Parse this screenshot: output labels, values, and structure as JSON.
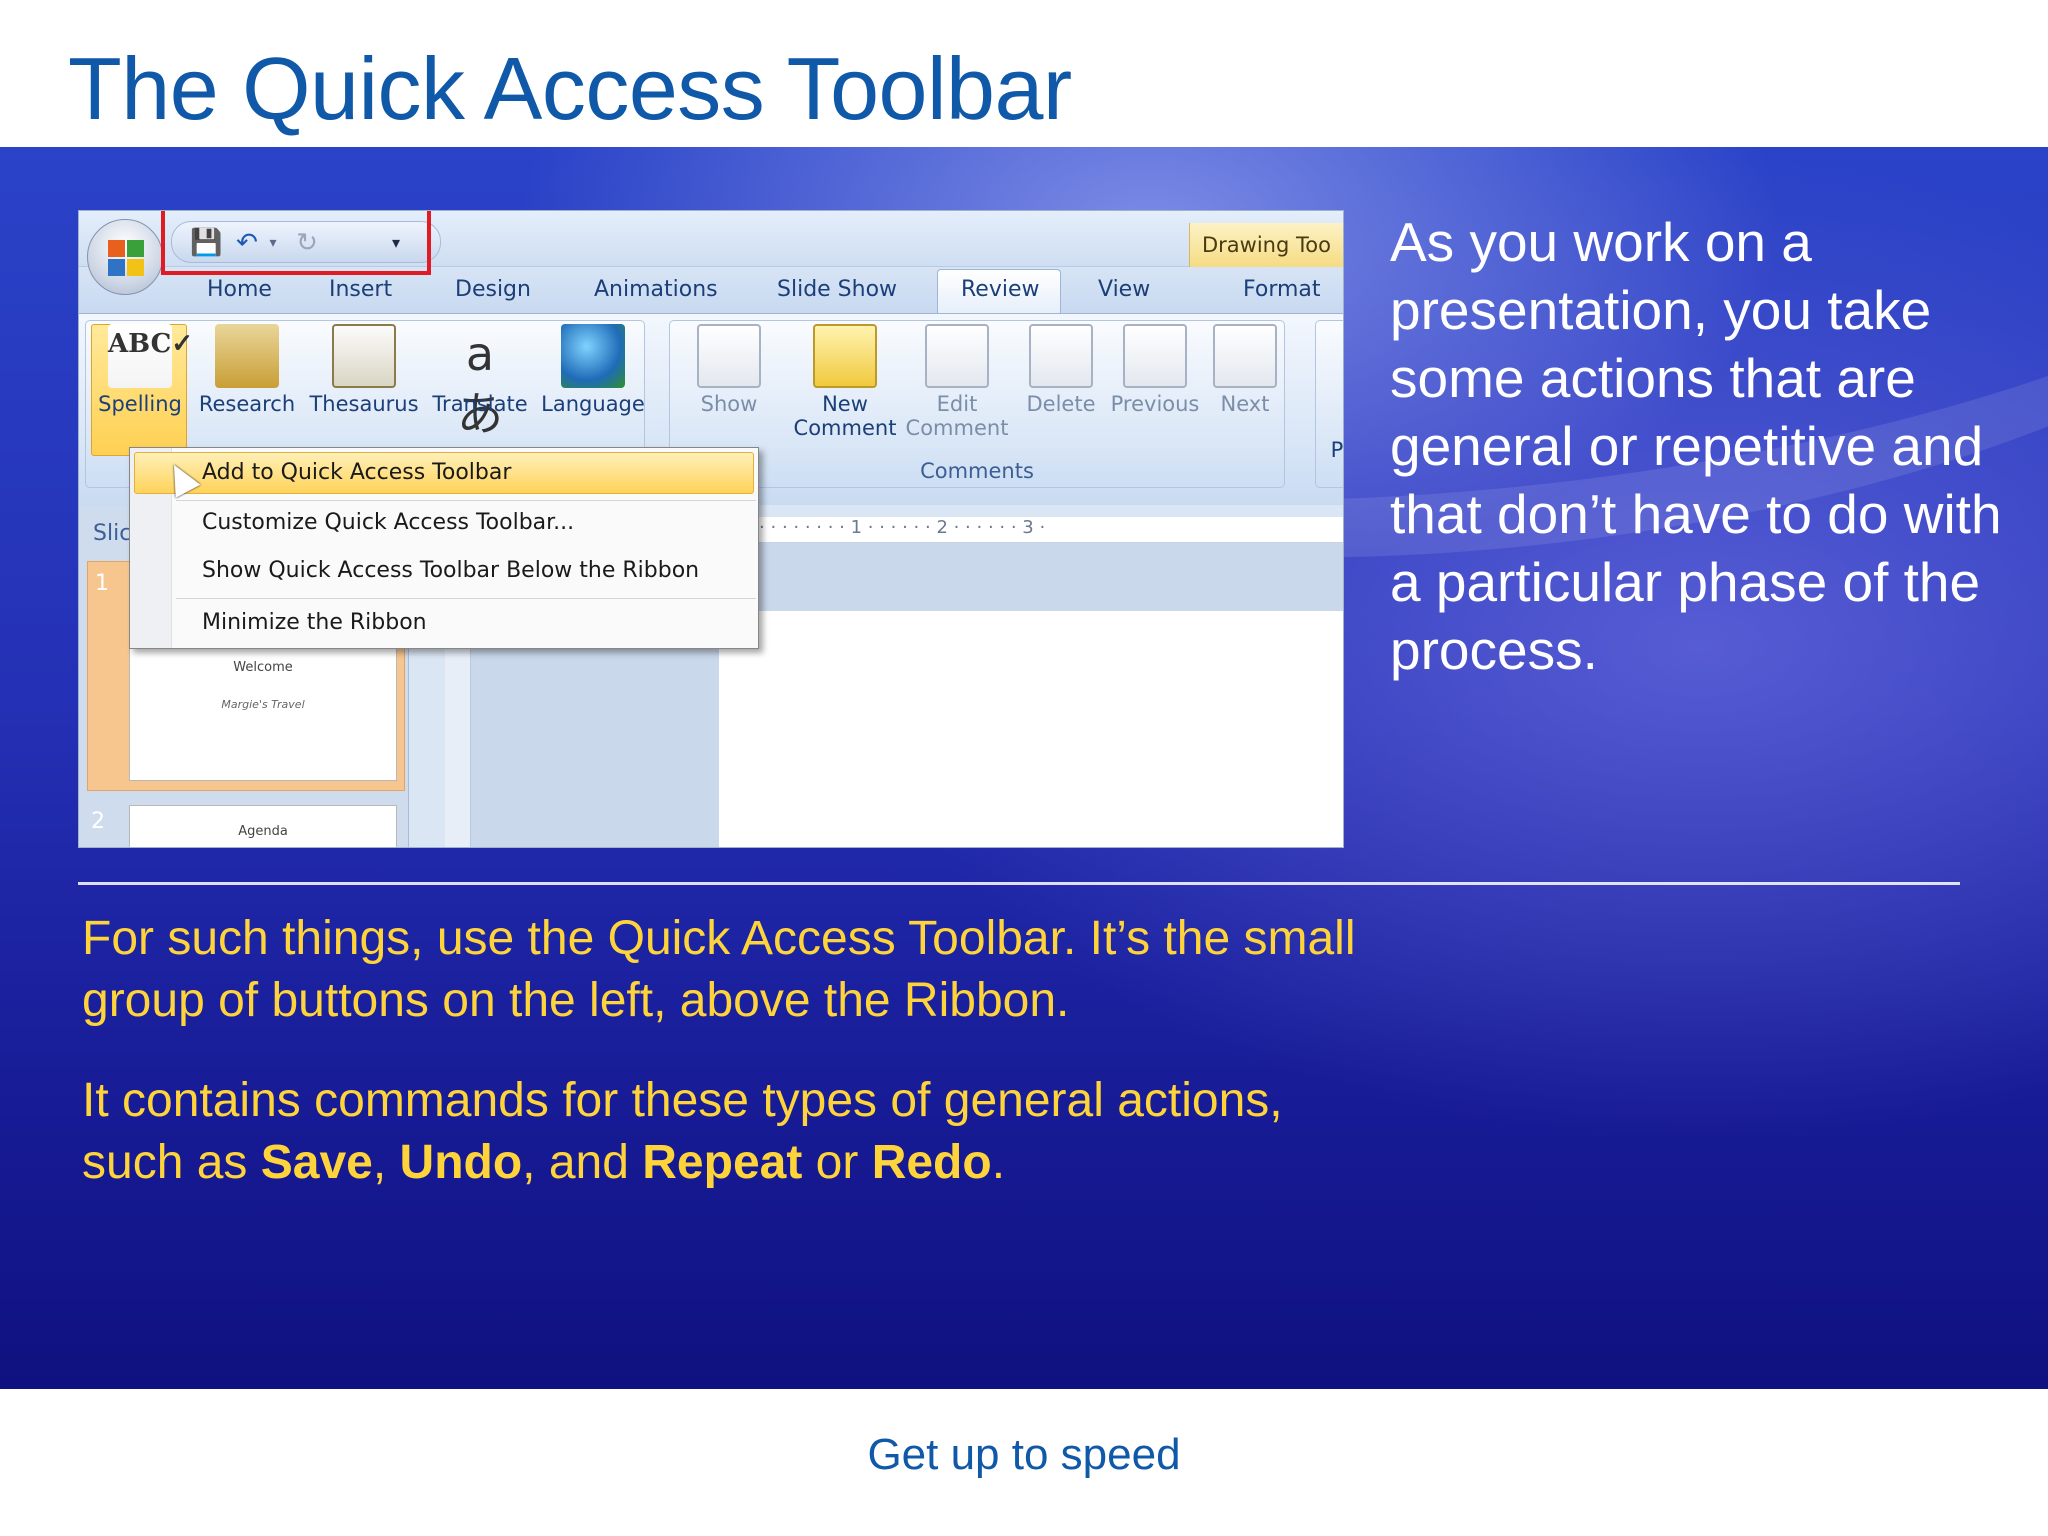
{
  "slide": {
    "title": "The Quick Access Toolbar",
    "right_text": "As you work on a presentation, you take some actions that are general or repetitive and that don’t have to do with a particular phase of the process.",
    "para1": "For such things, use the Quick Access Toolbar. It’s the small group of buttons on the left, above the Ribbon.",
    "para2": {
      "t1": "It contains commands for these types of general actions, such as ",
      "save": "Save",
      "t2": ", ",
      "undo": "Undo",
      "t3": ", and ",
      "repeat": "Repeat",
      "t4": " or ",
      "redo": "Redo",
      "t5": "."
    },
    "footer": "Get up to speed"
  },
  "app": {
    "contextual_tab": "Drawing Too",
    "tabs": [
      "Home",
      "Insert",
      "Design",
      "Animations",
      "Slide Show",
      "Review",
      "View",
      "Format"
    ],
    "active_tab": "Review",
    "qat_icons": [
      "save-icon",
      "undo-icon",
      "redo-icon",
      "customize-arrow-icon"
    ],
    "proofing_buttons": [
      "Spelling",
      "Research",
      "Thesaurus",
      "Translate",
      "Language"
    ],
    "show_markup": "Show",
    "comments_buttons": {
      "new_l1": "New",
      "new_l2": "Comment",
      "edit_l1": "Edit",
      "edit_l2": "Comment",
      "delete": "Delete",
      "previous": "Previous",
      "next": "Next"
    },
    "comments_group_label": "Comments",
    "cut_letter": "P",
    "slides_tab_label": "Slic",
    "thumb1": {
      "num": "1",
      "title": "Welcome",
      "subtitle": "Margie's Travel"
    },
    "thumb2": {
      "num": "2",
      "title": "Agenda"
    },
    "ruler": "· 1 · · · · · · · · · 1 · · · · · · 2 · · · · · · 3 ·",
    "context_menu": [
      "Add to Quick Access Toolbar",
      "Customize Quick Access Toolbar...",
      "Show Quick Access Toolbar Below the Ribbon",
      "Minimize the Ribbon"
    ]
  },
  "colors": {
    "title": "#1058a8",
    "accent_text": "#ffd43a",
    "panel": "#2430b5",
    "highlight_box": "#e01b24"
  }
}
